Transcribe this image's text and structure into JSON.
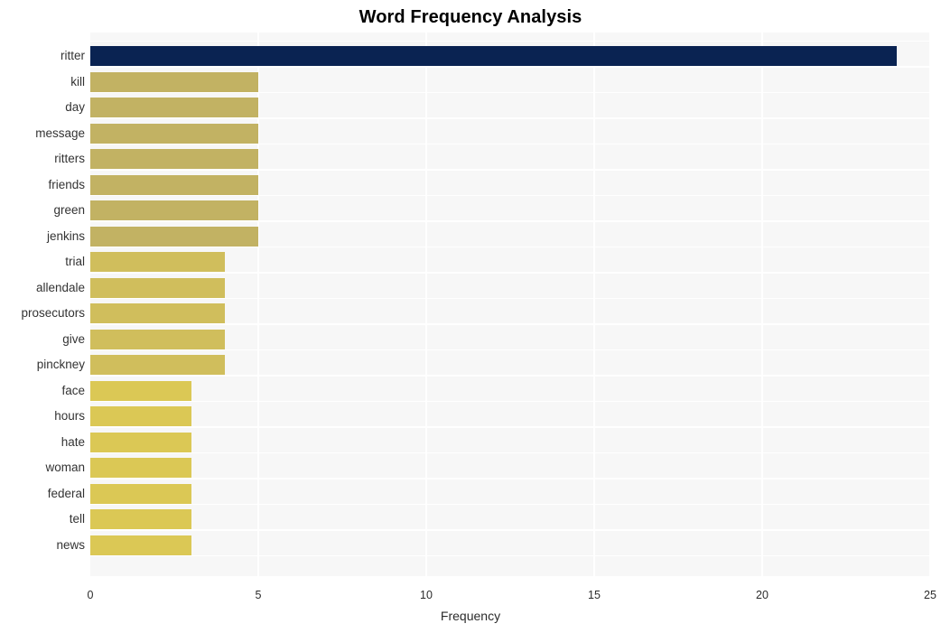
{
  "chart_data": {
    "type": "bar",
    "orientation": "horizontal",
    "title": "Word Frequency Analysis",
    "xlabel": "Frequency",
    "ylabel": "",
    "xlim": [
      0,
      25
    ],
    "ylim": null,
    "grid": true,
    "legend": null,
    "xticks": [
      {
        "value": 0,
        "label": "0"
      },
      {
        "value": 5,
        "label": "5"
      },
      {
        "value": 10,
        "label": "10"
      },
      {
        "value": 15,
        "label": "15"
      },
      {
        "value": 20,
        "label": "20"
      },
      {
        "value": 25,
        "label": "25"
      }
    ],
    "categories": [
      "ritter",
      "kill",
      "day",
      "message",
      "ritters",
      "friends",
      "green",
      "jenkins",
      "trial",
      "allendale",
      "prosecutors",
      "give",
      "pinckney",
      "face",
      "hours",
      "hate",
      "woman",
      "federal",
      "tell",
      "news"
    ],
    "values": [
      24,
      5,
      5,
      5,
      5,
      5,
      5,
      5,
      4,
      4,
      4,
      4,
      4,
      3,
      3,
      3,
      3,
      3,
      3,
      3
    ],
    "bar_colors": [
      "#0a2352",
      "#c2b263",
      "#c2b263",
      "#c2b263",
      "#c2b263",
      "#c2b263",
      "#c2b263",
      "#c2b263",
      "#d0be5c",
      "#d0be5c",
      "#d0be5c",
      "#d0be5c",
      "#d0be5c",
      "#dbc855",
      "#dbc855",
      "#dbc855",
      "#dbc855",
      "#dbc855",
      "#dbc855",
      "#dbc855"
    ]
  },
  "style": {
    "figure_background": "#ffffff",
    "plot_background": "#f7f7f7",
    "gridline_color": "#ffffff",
    "title_color": "#000000",
    "tick_label_color": "#2b2b2b",
    "axis_label_color": "#2b2b2b",
    "highlight_color": "#0a2352"
  }
}
